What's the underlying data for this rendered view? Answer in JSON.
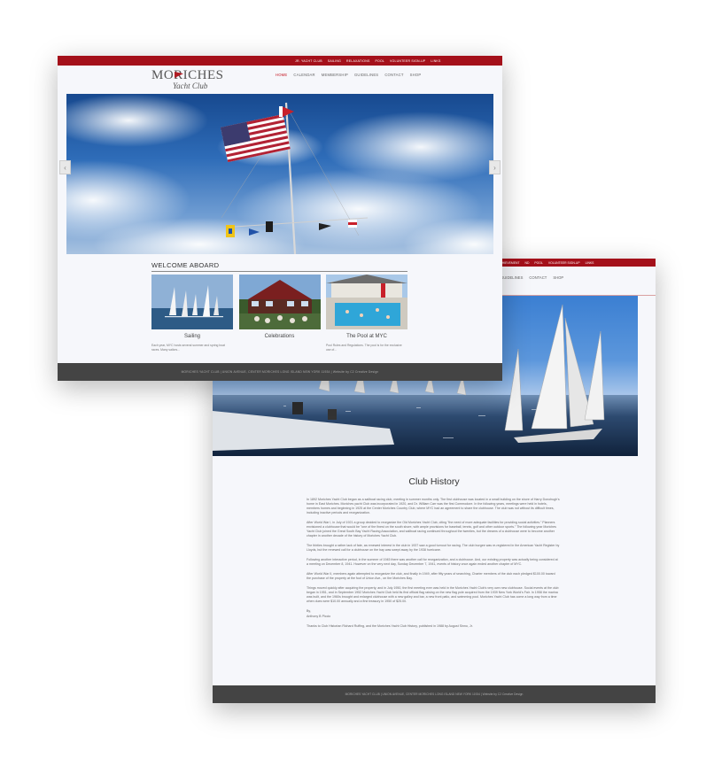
{
  "colors": {
    "accent": "#a4101a",
    "footer": "#444444",
    "page_bg": "#f6f7fb"
  },
  "history_page": {
    "top_links": [
      "ACHIEVEMENT",
      "ND",
      "POOL",
      "VOLUNTEER SIGN-UP",
      "LINKS"
    ],
    "nav": [
      "GUIDELINES",
      "CONTACT",
      "SHOP"
    ],
    "title": "Club History",
    "paragraphs": [
      "In 1892 Moriches Yacht Club began as a sailboat racing club, meeting in summer months only. The first clubhouse was located in a small building on the shore of Harry Donohugh's home in East Moriches. Moriches yacht Club was incorporated in 1920, and Dr. William Carr was the first Commodore. In the following years, meetings were held in hotels, members homes and beginning in 1925 at the Center Moriches Country Club, where MYC had an agreement to share the clubhouse. The club was not without its difficult times, including inactive periods and reorganization.",
      "After World War I, in July of 1921 a group decided to reorganize the Old Moriches Yacht Club, citing \"the need of more adequate facilities for providing social activities.\" Planners envisioned a clubhouse that would be \"one of the finest on the south shore, with ample provisions for baseball, tennis, golf and other outdoor sports.\" The following year Moriches Yacht Club joined the Great South Bay Yacht Racing Association, and sailboat racing continued throughout the twenties, but the dreams of a clubhouse were to become another chapter in another decade of the history of Moriches Yacht Club.",
      "The thirties brought a rather lack of fate, as renewed interest in the club in 1937 saw a good turnout for racing. The club burgee was re-registered in the American Yacht Register by Lloyds, but the renewed call for a clubhouse on the bay was swept away by the 1938 hurricane.",
      "Following another interactive period, in the summer of 1945 there was another call for reorganization, and a clubhouse. And, our existing property was actually being considered at a meeting on December 8, 1941. However on the very next day, Sunday December 7, 1941, events of history once again ended another chapter of MYC.",
      "After World War II, members again attempted to reorganize the club, and finally in 1949, after fifty years of searching, Charter members of the club each pledged $100.00 toward the purchase of the property at the foot of Union Ave., on the Moriches Bay.",
      "Things moved quickly after acquiring the property, and in July 1950, the first meeting ever was held in the Moriches Yacht Club's very own new clubhouse. Social events at the club began in 1951, and in September 1952 Moriches Yacht Club held its first official flag raising on the new flag pole acquired from the 1939 New York World's Fair. In 1958 the marina was built, and the 1960s brought and enlarged clubhouse with a new galley and bar, a new front patio, and swimming pool. Moriches Yacht Club has come a long way from a time when dues were $10.00 annually and a first treasury in 1950 of $25.00.",
      "By,",
      "Anthony B Piccio",
      "Thanks to Club Historian Richard Ruffing, and the Moriches Yacht Club History, published in 1988 by August Sinno, Jr."
    ],
    "footer": "MORICHES YACHT CLUB  |  UNION AVENUE, CENTER MORICHES LONG ISLAND NEW YORK 11934  |  Website by C2 Creative Design"
  },
  "home_page": {
    "top_links": [
      "JR. YACHT CLUB",
      "SAILING",
      "RELAXATIONS",
      "POOL",
      "VOLUNTEER SIGN-UP",
      "LINKS"
    ],
    "logo": {
      "line1": "MORICHES",
      "line2": "Yacht Club"
    },
    "nav": [
      {
        "label": "HOME",
        "active": true
      },
      {
        "label": "CALENDAR",
        "active": false
      },
      {
        "label": "MEMBERSHIP",
        "active": false
      },
      {
        "label": "GUIDELINES",
        "active": false
      },
      {
        "label": "CONTACT",
        "active": false
      },
      {
        "label": "SHOP",
        "active": false
      }
    ],
    "slider_prev": "‹",
    "slider_next": "›",
    "welcome_title": "WELCOME ABOARD",
    "tiles": [
      {
        "title": "Sailing",
        "desc": "Each year, MYC hosts several summer and spring boat races. Many sailors..."
      },
      {
        "title": "Celebrations",
        "desc": ""
      },
      {
        "title": "The Pool at MYC",
        "desc": "Pool Rules and Regulations. The pool is for the exclusive use of..."
      }
    ],
    "footer": "MORICHES YACHT CLUB  |  UNION AVENUE, CENTER MORICHES LONG ISLAND NEW YORK 11934  |  Website by C2 Creative Design"
  }
}
